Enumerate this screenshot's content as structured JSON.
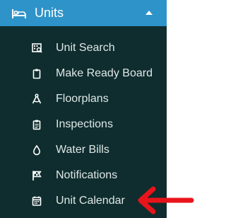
{
  "section": {
    "label": "Units",
    "icon": "bed-icon",
    "expanded": true,
    "colors": {
      "header_bg": "#2e93c8",
      "sidebar_bg": "#0f2d2e",
      "text": "#dfe7e7"
    }
  },
  "items": [
    {
      "label": "Unit Search",
      "icon": "search-building-icon"
    },
    {
      "label": "Make Ready Board",
      "icon": "clipboard-icon"
    },
    {
      "label": "Floorplans",
      "icon": "compass-drafting-icon"
    },
    {
      "label": "Inspections",
      "icon": "clipboard-list-icon"
    },
    {
      "label": "Water Bills",
      "icon": "water-drop-icon"
    },
    {
      "label": "Notifications",
      "icon": "flag-icon"
    },
    {
      "label": "Unit Calendar",
      "icon": "calendar-icon"
    }
  ],
  "annotation": {
    "icon": "red-arrow-icon",
    "color": "#e8141b",
    "points_to": "Unit Calendar"
  }
}
